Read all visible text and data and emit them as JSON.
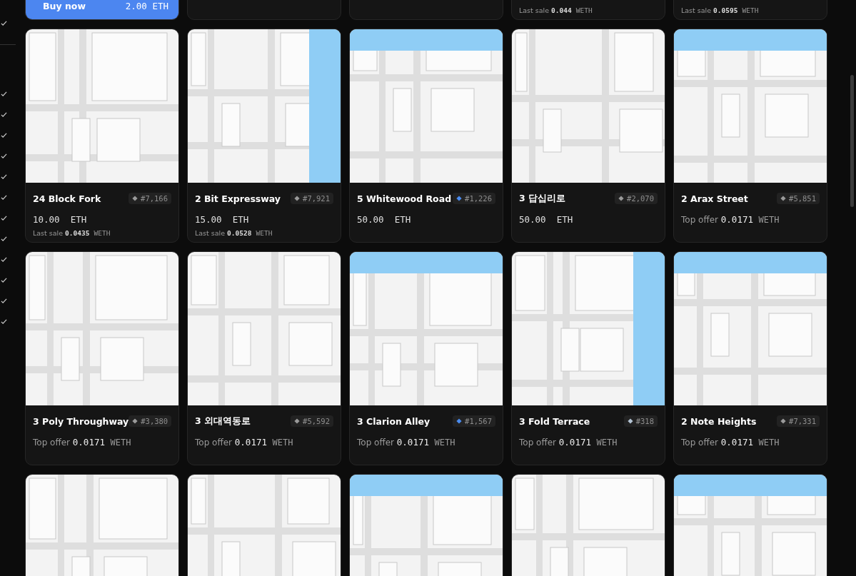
{
  "sidebar": {
    "items": [
      {
        "checked": true
      },
      {
        "checked": true
      },
      {
        "checked": true
      },
      {
        "checked": true
      },
      {
        "checked": true
      },
      {
        "checked": true
      },
      {
        "checked": true
      },
      {
        "checked": true
      },
      {
        "checked": true
      },
      {
        "checked": true
      },
      {
        "checked": true
      },
      {
        "checked": true
      },
      {
        "checked": true
      }
    ]
  },
  "cards": [
    {
      "kind": "hovered",
      "buy_button": {
        "label": "Buy now",
        "price": "2.00 ETH"
      }
    },
    {
      "kind": "listing"
    },
    {
      "kind": "listing"
    },
    {
      "kind": "listing",
      "sub_label": "Last sale",
      "sub_value": "0.044",
      "sub_unit": "WETH"
    },
    {
      "kind": "listing",
      "sub_label": "Last sale",
      "sub_value": "0.0595",
      "sub_unit": "WETH"
    },
    {
      "image": {
        "kind": "picture"
      },
      "name": "24 Block Fork",
      "token": "#7,166",
      "color": "#9a9a9a",
      "price": "10.00",
      "unit": "ETH",
      "sub_label": "Last sale",
      "sub_value": "0.0435",
      "sub_unit": "WETH"
    },
    {
      "image": {
        "kind": "picture"
      },
      "name": "2 Bit Expressway",
      "token": "#7,921",
      "color": "#9a9a9a",
      "price": "15.00",
      "unit": "ETH",
      "sub_label": "Last sale",
      "sub_value": "0.0528",
      "sub_unit": "WETH"
    },
    {
      "image": {
        "kind": "picture"
      },
      "name": "5 Whitewood Road",
      "token": "#1,226",
      "color": "#4a8cf0",
      "price": "50.00",
      "unit": "ETH"
    },
    {
      "image": {
        "kind": "picture"
      },
      "name": "3 답십리로",
      "token": "#2,070",
      "color": "#9a9a9a",
      "price": "50.00",
      "unit": "ETH"
    },
    {
      "image": {
        "kind": "picture"
      },
      "name": "2 Arax Street",
      "token": "#5,851",
      "color": "#9a9a9a",
      "offer_label": "Top offer",
      "offer_value": "0.0171",
      "offer_unit": "WETH"
    },
    {
      "image": {
        "kind": "picture"
      },
      "name": "3 Poly Throughway",
      "token": "#3,380",
      "color": "#9a9a9a",
      "offer_label": "Top offer",
      "offer_value": "0.0171",
      "offer_unit": "WETH"
    },
    {
      "image": {
        "kind": "picture"
      },
      "name": "3 외대역동로",
      "token": "#5,592",
      "color": "#9a9a9a",
      "offer_label": "Top offer",
      "offer_value": "0.0171",
      "offer_unit": "WETH"
    },
    {
      "image": {
        "kind": "picture"
      },
      "name": "3 Clarion Alley",
      "token": "#1,567",
      "color": "#4a8cf0",
      "offer_label": "Top offer",
      "offer_value": "0.0171",
      "offer_unit": "WETH"
    },
    {
      "image": {
        "kind": "picture"
      },
      "name": "3 Fold Terrace",
      "token": "#318",
      "color": "#b4c4d4",
      "offer_label": "Top offer",
      "offer_value": "0.0171",
      "offer_unit": "WETH"
    },
    {
      "image": {
        "kind": "picture"
      },
      "name": "2 Note Heights",
      "token": "#7,331",
      "color": "#9a9a9a",
      "offer_label": "Top offer",
      "offer_value": "0.0171",
      "offer_unit": "WETH"
    },
    {
      "image": {
        "kind": "picture"
      }
    },
    {
      "image": {
        "kind": "picture"
      }
    },
    {
      "image": {
        "kind": "picture"
      }
    },
    {
      "image": {
        "kind": "picture"
      }
    },
    {
      "image": {
        "kind": "picture"
      }
    }
  ]
}
